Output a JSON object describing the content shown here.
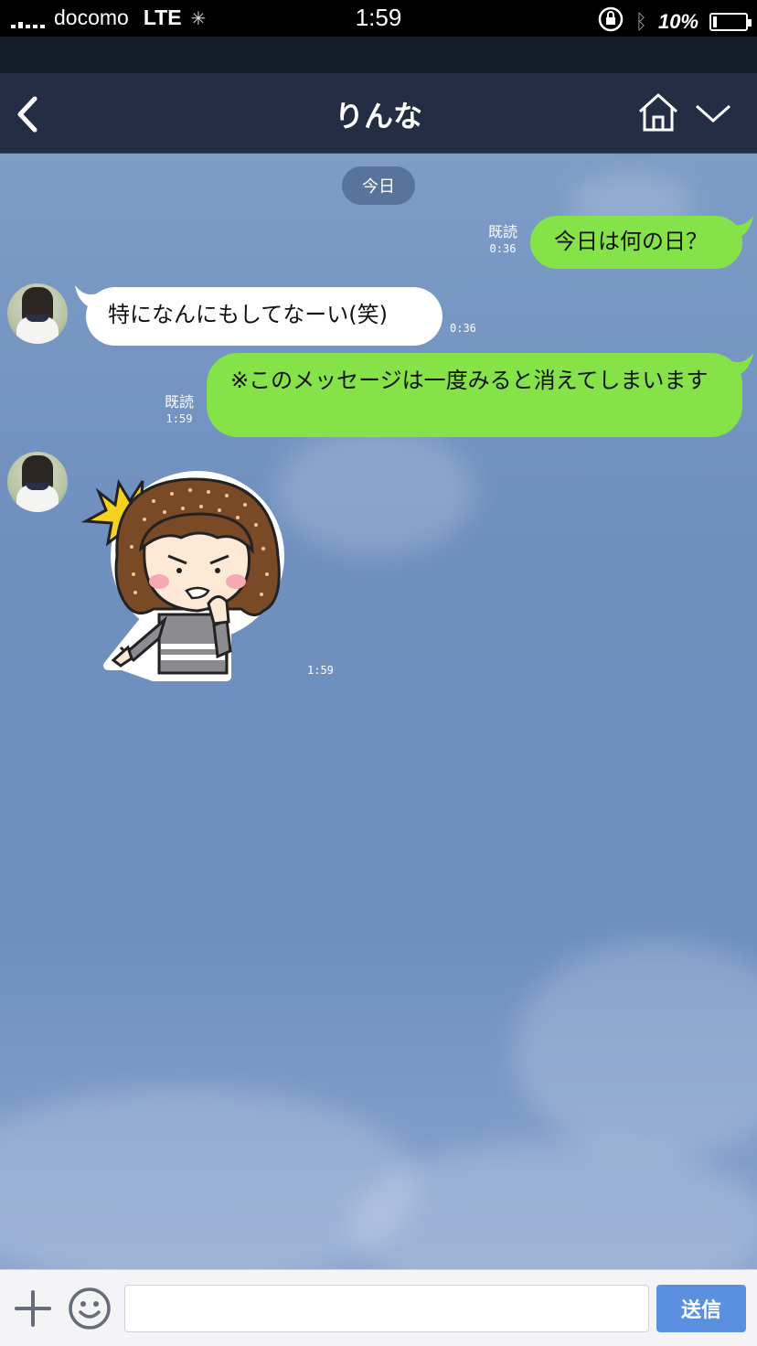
{
  "status_bar": {
    "carrier": "docomo",
    "network": "LTE",
    "time": "1:59",
    "battery": "10%"
  },
  "header": {
    "title": "りんな",
    "back_icon": "chevron-left-icon",
    "home_icon": "home-icon",
    "menu_icon": "chevron-down-icon"
  },
  "chat": {
    "date_label": "今日",
    "messages": [
      {
        "direction": "out",
        "text": "今日は何の日？",
        "read": "既読",
        "time": "0:36"
      },
      {
        "direction": "in",
        "text": "特になんにもしてなーい(笑)",
        "time": "0:36"
      },
      {
        "direction": "out",
        "text": "※このメッセージは一度みると消えてしまいます",
        "read": "既読",
        "time": "1:59"
      },
      {
        "direction": "in",
        "type": "sticker",
        "sticker_icon": "angry-girl-sticker",
        "time": "1:59"
      }
    ]
  },
  "input_bar": {
    "plus_icon": "plus-icon",
    "emoji_icon": "smiley-icon",
    "input_value": "",
    "input_placeholder": "",
    "send_label": "送信"
  },
  "colors": {
    "header_bg": "#232d43",
    "chat_bg": "#7293c2",
    "outgoing_bubble": "#85e249",
    "incoming_bubble": "#ffffff",
    "send_button": "#5b8fe0"
  }
}
